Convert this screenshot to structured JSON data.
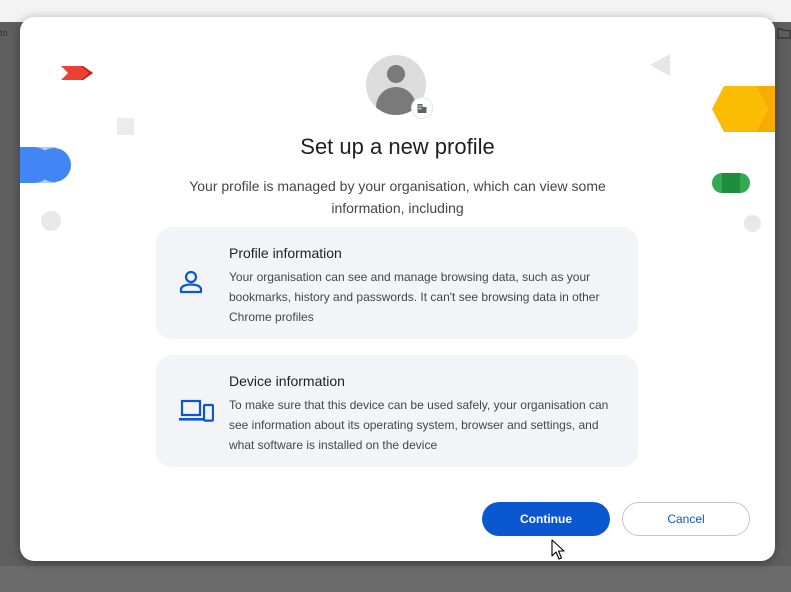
{
  "background": {
    "edge_text": "to",
    "folder_icon": "folder-icon"
  },
  "dialog": {
    "avatar_icon": "default-avatar-icon",
    "badge_icon": "managed-building-icon",
    "title": "Set up a new profile",
    "subtitle": "Your profile is managed by your organisation, which can view some information, including",
    "cards": [
      {
        "icon": "person-icon",
        "heading": "Profile information",
        "text": "Your organisation can see and manage browsing data, such as your bookmarks, history and passwords. It can't see browsing data in other Chrome profiles"
      },
      {
        "icon": "devices-icon",
        "heading": "Device information",
        "text": "To make sure that this device can be used safely, your organisation can see information about its operating system, browser and settings, and what software is installed on the device"
      }
    ],
    "buttons": {
      "continue_label": "Continue",
      "cancel_label": "Cancel"
    }
  },
  "colors": {
    "primary": "#0b57d0",
    "card_bg": "#f3f4f7",
    "deco_red": "#e94235",
    "deco_blue": "#4285f4",
    "deco_yellow": "#fbbc04",
    "deco_green": "#34a853"
  }
}
